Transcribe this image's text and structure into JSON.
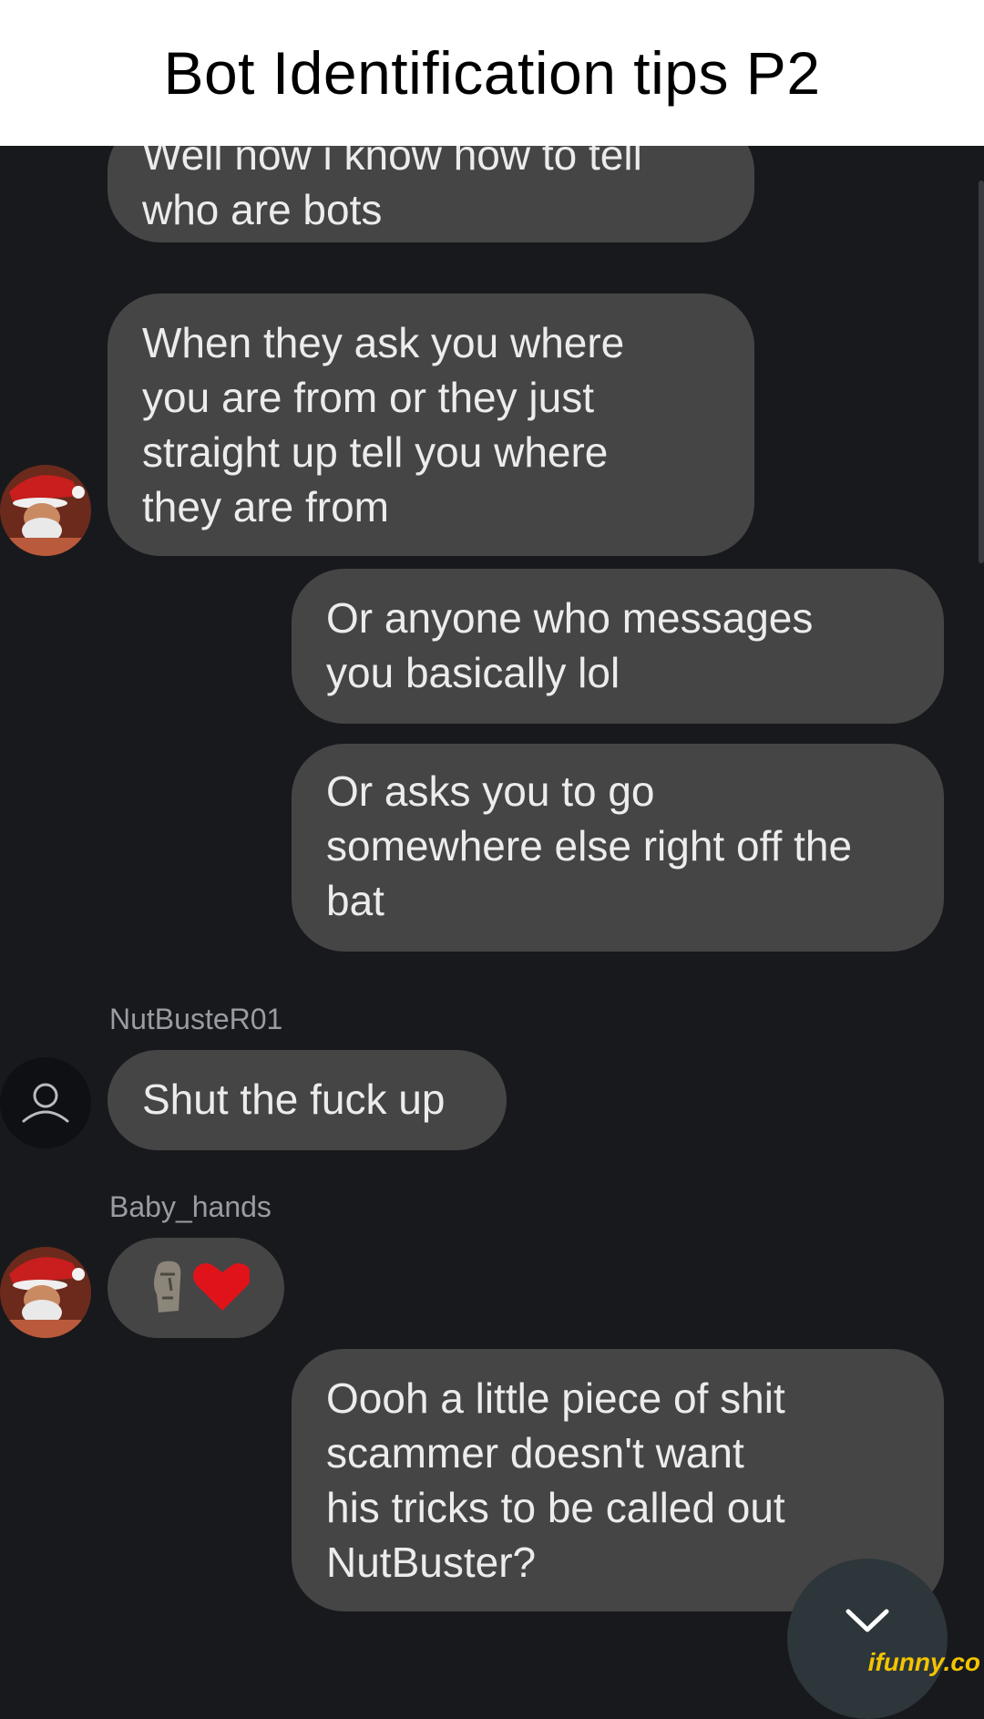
{
  "header": {
    "title": "Bot Identification tips P2"
  },
  "messages": [
    {
      "text": "Well now i know how to tell\nwho are bots"
    },
    {
      "text": "When they ask you where\nyou are from or they just\nstraight up tell you where\nthey are from"
    },
    {
      "text": "Or anyone who messages\nyou basically lol"
    },
    {
      "text": "Or asks you to go\nsomewhere else right off the\nbat"
    },
    {
      "username": "NutBusteR01",
      "text": "Shut the fuck up"
    },
    {
      "username": "Baby_hands",
      "emoji": "moai-heart"
    },
    {
      "text": "Oooh a little piece of shit\nscammer doesn't want\nhis tricks to be called out\nNutBuster?"
    }
  ],
  "icons": {
    "avatar_default": "person-icon",
    "scroll_button": "chevron-down-icon",
    "emoji_1": "moai-emoji-icon",
    "emoji_2": "red-heart-emoji-icon"
  },
  "watermark": "ifunny.co",
  "colors": {
    "background": "#18191d",
    "bubble": "#454545",
    "bubble_text": "#ececec",
    "username": "#9a9ca3",
    "watermark": "#f4c400"
  }
}
